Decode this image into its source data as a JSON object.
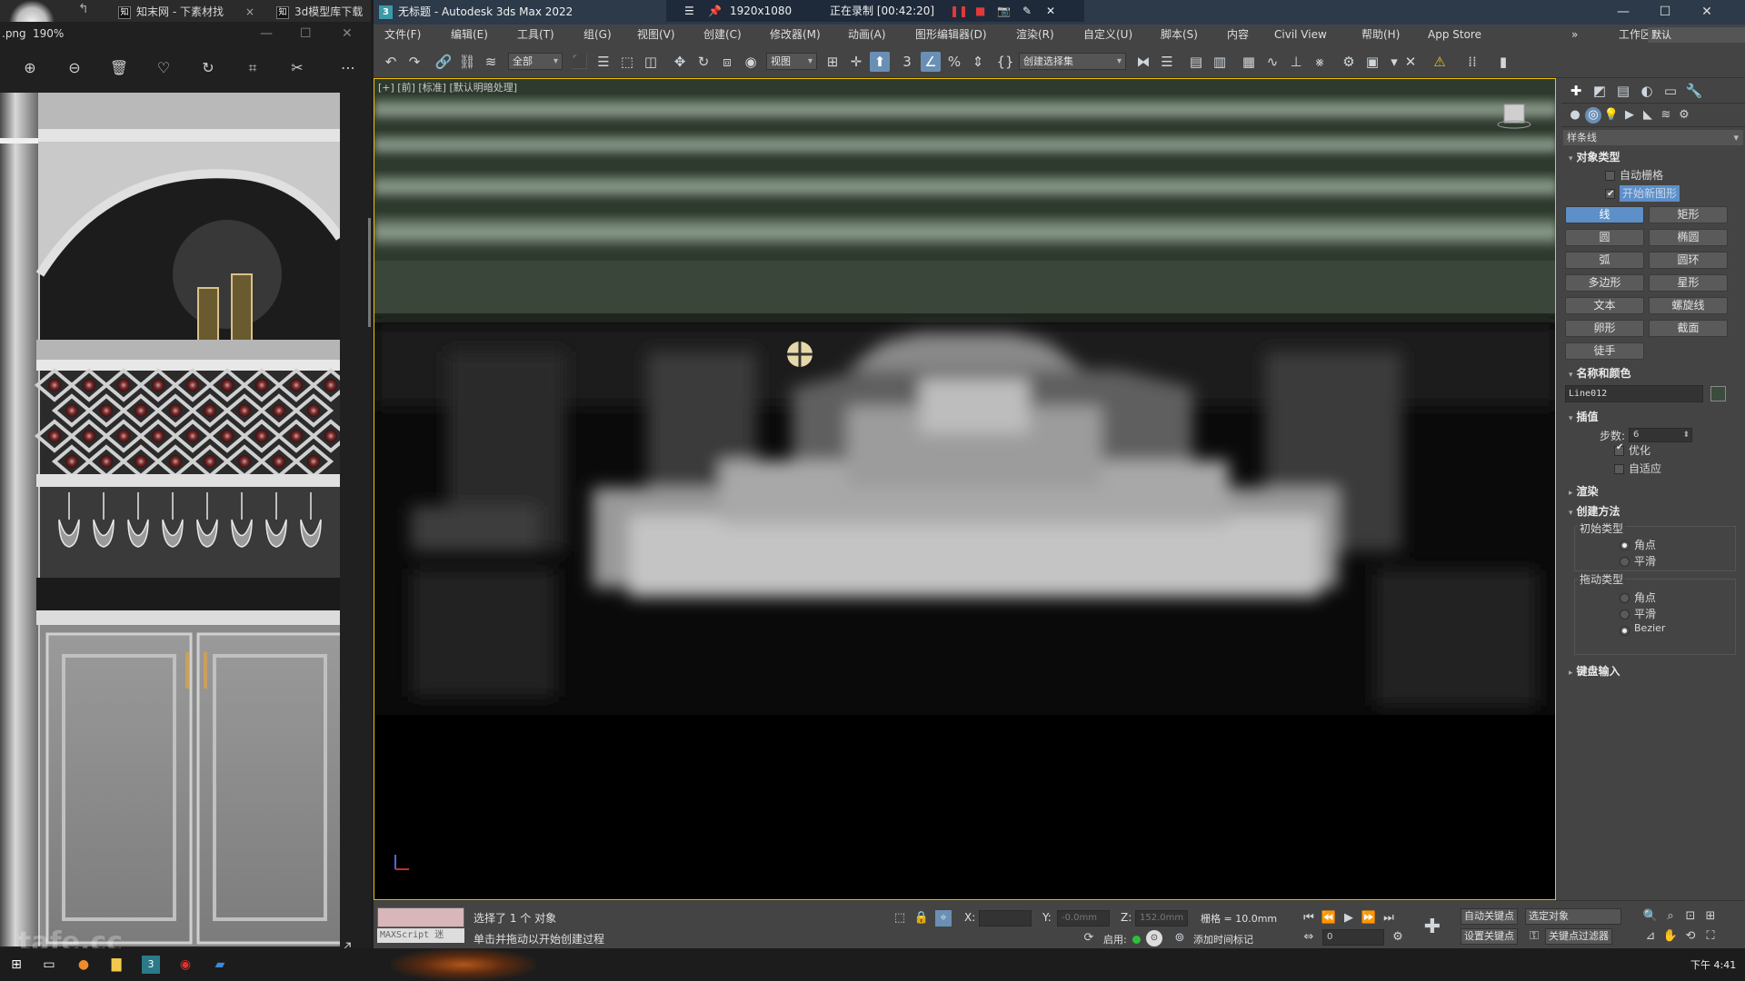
{
  "viewer": {
    "tabs": [
      {
        "icon": "知",
        "label": "知末网 - 下素材找"
      },
      {
        "icon": "知",
        "label": "3d模型库下载"
      }
    ],
    "file_suffix": ".png",
    "zoom": "190%",
    "watermark": "tafe.cc"
  },
  "max": {
    "window_title": "无标题 - Autodesk 3ds Max 2022",
    "recorder": {
      "resolution": "1920x1080",
      "status": "正在录制 [00:42:20]"
    },
    "menus": [
      "文件(F)",
      "编辑(E)",
      "工具(T)",
      "组(G)",
      "视图(V)",
      "创建(C)",
      "修改器(M)",
      "动画(A)",
      "图形编辑器(D)",
      "渲染(R)",
      "自定义(U)",
      "脚本(S)",
      "内容",
      "Civil View",
      "帮助(H)",
      "App Store"
    ],
    "workspace": {
      "label": "工作区:",
      "value": "默认"
    },
    "toolbar": {
      "selection_filter": "全部",
      "ref_coord": "视图",
      "named_selection": "创建选择集"
    },
    "viewport_label": "[+] [前] [标准] [默认明暗处理]",
    "command_panel": {
      "category": "样条线",
      "object_type": {
        "title": "对象类型",
        "autogrid": "自动栅格",
        "start_new_shape": "开始新图形",
        "buttons": [
          "线",
          "矩形",
          "圆",
          "椭圆",
          "弧",
          "圆环",
          "多边形",
          "星形",
          "文本",
          "螺旋线",
          "卵形",
          "截面",
          "徒手"
        ]
      },
      "name_color": {
        "title": "名称和颜色",
        "name": "Line012"
      },
      "interpolation": {
        "title": "插值",
        "steps_label": "步数:",
        "steps": "6",
        "optimize": "优化",
        "adaptive": "自适应"
      },
      "rendering": {
        "title": "渲染"
      },
      "creation_method": {
        "title": "创建方法",
        "initial_type": "初始类型",
        "initial_options": [
          "角点",
          "平滑"
        ],
        "drag_type": "拖动类型",
        "drag_options": [
          "角点",
          "平滑",
          "Bezier"
        ]
      },
      "keyboard_entry": {
        "title": "键盘输入"
      }
    },
    "status": {
      "maxscript": "MAXScript 迷",
      "selection": "选择了 1 个 对象",
      "prompt": "单击并拖动以开始创建过程",
      "x_label": "X:",
      "x_value": "",
      "y_label": "Y:",
      "y_value": "-0.0mm",
      "z_label": "Z:",
      "z_value": "152.0mm",
      "grid": "栅格 = 10.0mm",
      "enable_label": "启用:",
      "add_time_tag": "添加时间标记",
      "auto_key": "自动关键点",
      "set_key": "设置关键点",
      "selected_object": "选定对象",
      "key_filters": "关键点过滤器",
      "frame": "0"
    }
  },
  "taskbar": {
    "clock": "下午 4:41"
  },
  "colors": {
    "accent": "#5d8fc8",
    "viewport_border": "#f0c400",
    "title_bg": "#2d3a4a"
  }
}
